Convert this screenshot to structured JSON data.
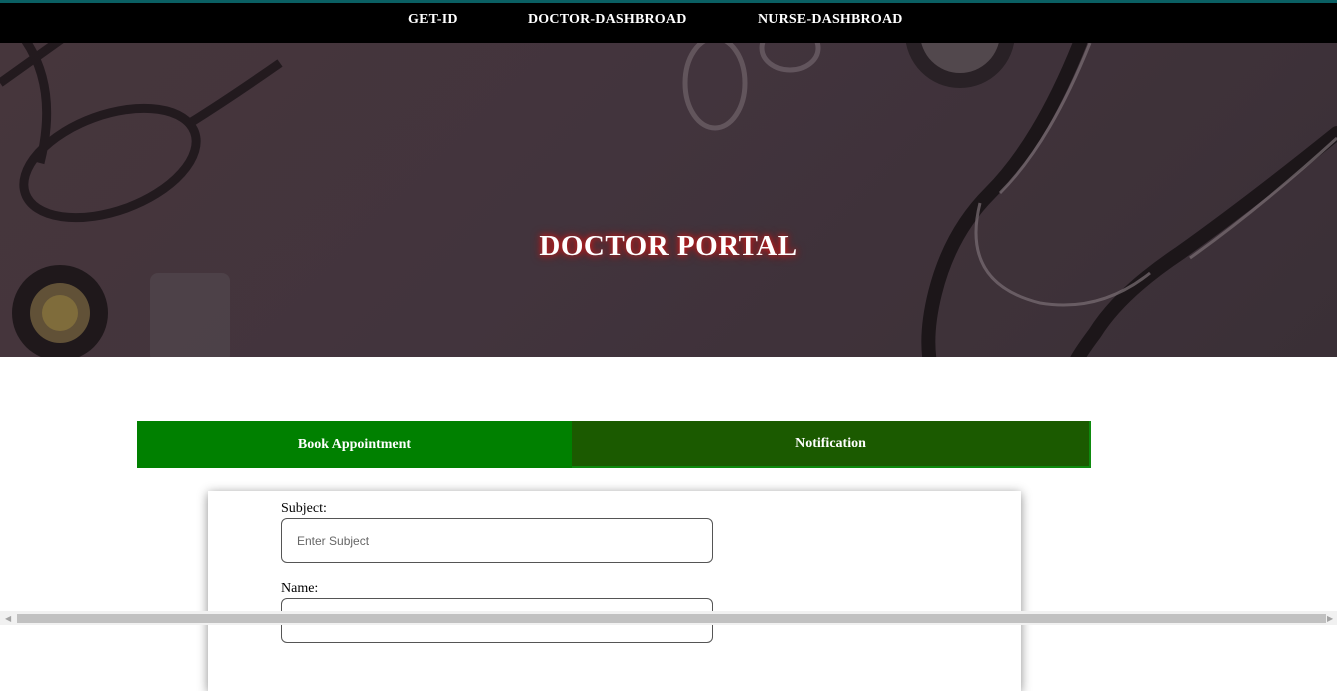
{
  "nav": {
    "items": [
      {
        "label": "GET-ID"
      },
      {
        "label": "DOCTOR-DASHBROAD"
      },
      {
        "label": "NURSE-DASHBROAD"
      }
    ]
  },
  "hero": {
    "title": "DOCTOR PORTAL"
  },
  "tabs": {
    "book_label": "Book Appointment",
    "notification_label": "Notification"
  },
  "form": {
    "subject_label": "Subject:",
    "subject_placeholder": "Enter Subject",
    "subject_value": "",
    "name_label": "Name:",
    "name_value": ""
  },
  "colors": {
    "nav_bg": "#000000",
    "nav_accent": "#0a5f63",
    "tab_active": "#008000",
    "tab_inactive": "#1b5a00",
    "title_glow": "#d21b1b"
  },
  "icons": {
    "scroll_left": "scroll-left-arrow-icon",
    "scroll_right": "scroll-right-arrow-icon"
  }
}
